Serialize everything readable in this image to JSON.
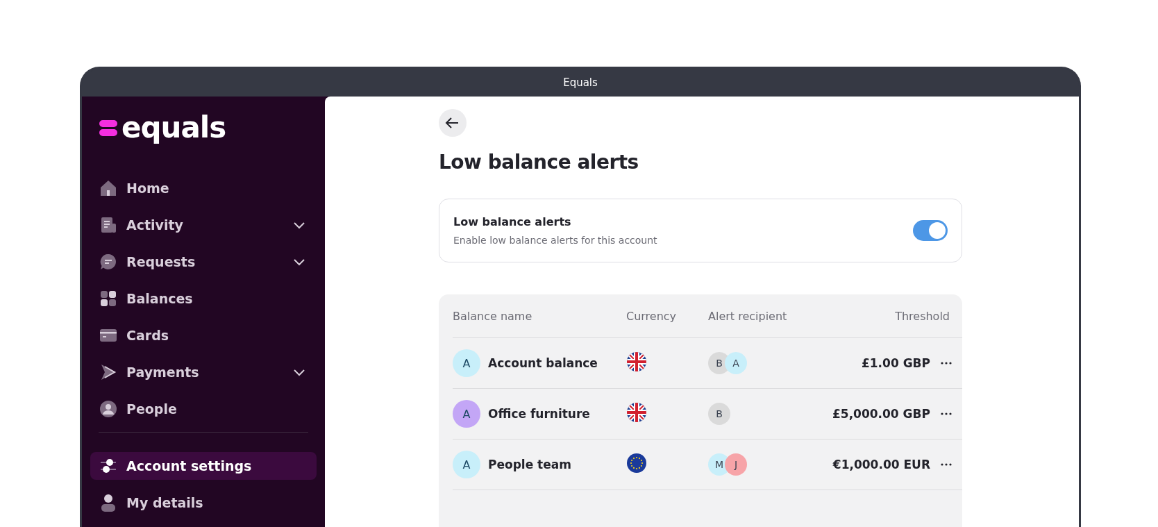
{
  "window": {
    "title": "Equals"
  },
  "sidebar": {
    "logo": "equals",
    "items": [
      {
        "label": "Home",
        "kind": "home",
        "expandable": false,
        "selected": false
      },
      {
        "label": "Activity",
        "kind": "activity",
        "expandable": true,
        "selected": false
      },
      {
        "label": "Requests",
        "kind": "requests",
        "expandable": true,
        "selected": false
      },
      {
        "label": "Balances",
        "kind": "balances",
        "expandable": false,
        "selected": false
      },
      {
        "label": "Cards",
        "kind": "cards",
        "expandable": false,
        "selected": false
      },
      {
        "label": "Payments",
        "kind": "payments",
        "expandable": true,
        "selected": false
      },
      {
        "label": "People",
        "kind": "people",
        "expandable": false,
        "selected": false
      }
    ],
    "bottom_items": [
      {
        "label": "Account settings",
        "kind": "settings",
        "expandable": false,
        "selected": true
      },
      {
        "label": "My details",
        "kind": "person",
        "expandable": false,
        "selected": false
      }
    ]
  },
  "page": {
    "title": "Low balance alerts"
  },
  "alert_setting": {
    "title": "Low balance alerts",
    "description": "Enable low balance alerts for this account",
    "on": true
  },
  "table": {
    "columns": [
      "Balance name",
      "Currency",
      "Alert recipient",
      "Threshold"
    ],
    "rows": [
      {
        "avatar": {
          "initial": "A",
          "color": "#c8effa"
        },
        "name": "Account balance",
        "currency": {
          "kind": "gb"
        },
        "recipients": [
          {
            "initial": "B",
            "color": "#dadada"
          },
          {
            "initial": "A",
            "color": "#c8effa"
          }
        ],
        "threshold": "£1.00 GBP"
      },
      {
        "avatar": {
          "initial": "A",
          "color": "#c3a6f6"
        },
        "name": "Office furniture",
        "currency": {
          "kind": "gb"
        },
        "recipients": [
          {
            "initial": "B",
            "color": "#dadada"
          }
        ],
        "threshold": "£5,000.00 GBP"
      },
      {
        "avatar": {
          "initial": "A",
          "color": "#c8effa"
        },
        "name": "People team",
        "currency": {
          "kind": "eu"
        },
        "recipients": [
          {
            "initial": "M",
            "color": "#c8effa"
          },
          {
            "initial": "J",
            "color": "#f7a4a8"
          }
        ],
        "threshold": "€1,000.00 EUR"
      }
    ]
  }
}
